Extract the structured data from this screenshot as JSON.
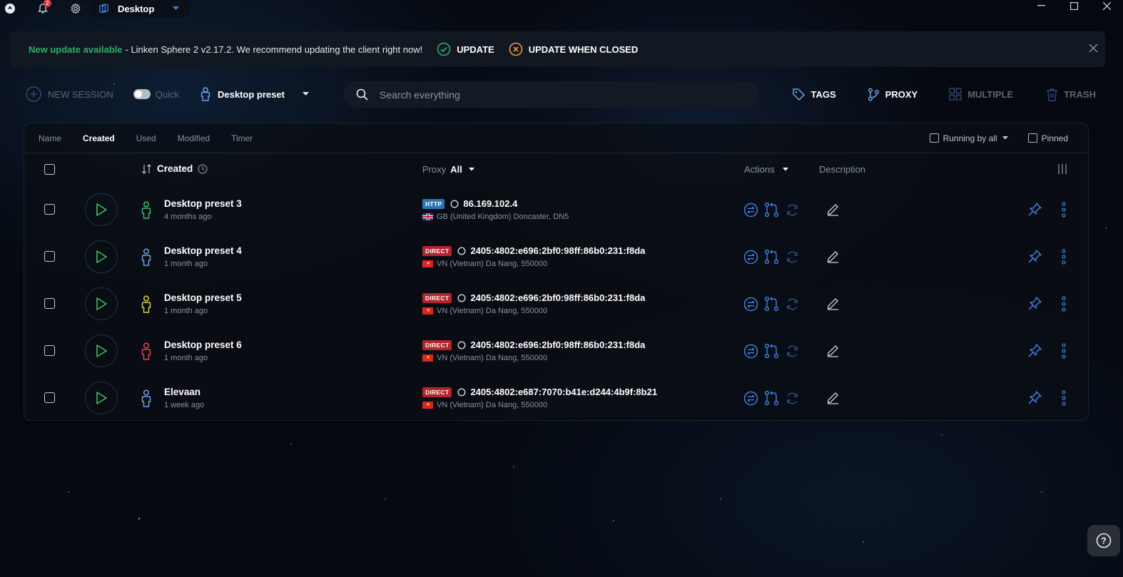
{
  "titlebar": {
    "notification_count": "2",
    "tab_label": "Desktop"
  },
  "banner": {
    "highlight": "New update available",
    "message": "- Linken Sphere 2 v2.17.2. We recommend updating the client right now!",
    "update_label": "UPDATE",
    "update_closed_label": "UPDATE WHEN CLOSED"
  },
  "toolbar": {
    "new_session": "NEW SESSION",
    "quick": "Quick",
    "preset": "Desktop preset",
    "search_placeholder": "Search everything",
    "tags": "TAGS",
    "proxy": "PROXY",
    "multiple": "MULTIPLE",
    "trash": "TRASH"
  },
  "sortbar": {
    "options": [
      "Name",
      "Created",
      "Used",
      "Modified",
      "Timer"
    ],
    "active": "Created",
    "running_by": "Running by all",
    "pinned": "Pinned"
  },
  "table_header": {
    "created": "Created",
    "proxy": "Proxy",
    "proxy_filter": "All",
    "actions": "Actions",
    "description": "Description"
  },
  "sessions": [
    {
      "name": "Desktop preset 3",
      "ago": "4 months ago",
      "user_color": "#3fbf6a",
      "proxy_type": "HTTP",
      "ip": "86.169.102.4",
      "flag": "gb",
      "location": "GB (United Kingdom) Doncaster, DN5"
    },
    {
      "name": "Desktop preset 4",
      "ago": "1 month ago",
      "user_color": "#6fa4e6",
      "proxy_type": "DIRECT",
      "ip": "2405:4802:e696:2bf0:98ff:86b0:231:f8da",
      "flag": "vn",
      "location": "VN (Vietnam) Da Nang, 550000"
    },
    {
      "name": "Desktop preset 5",
      "ago": "1 month ago",
      "user_color": "#d8d04a",
      "proxy_type": "DIRECT",
      "ip": "2405:4802:e696:2bf0:98ff:86b0:231:f8da",
      "flag": "vn",
      "location": "VN (Vietnam) Da Nang, 550000"
    },
    {
      "name": "Desktop preset 6",
      "ago": "1 month ago",
      "user_color": "#e0474c",
      "proxy_type": "DIRECT",
      "ip": "2405:4802:e696:2bf0:98ff:86b0:231:f8da",
      "flag": "vn",
      "location": "VN (Vietnam) Da Nang, 550000"
    },
    {
      "name": "Elevaan",
      "ago": "1 week ago",
      "user_color": "#6fa4e6",
      "proxy_type": "DIRECT",
      "ip": "2405:4802:e687:7070:b41e:d244:4b9f:8b21",
      "flag": "vn",
      "location": "VN (Vietnam) Da Nang, 550000"
    }
  ],
  "colors": {
    "accent_blue": "#3f7fe0",
    "update_green": "#2fae6a",
    "update_orange": "#e8973b",
    "direct_red": "#b3242c",
    "http_blue": "#2d73b4"
  },
  "help_label": "?"
}
